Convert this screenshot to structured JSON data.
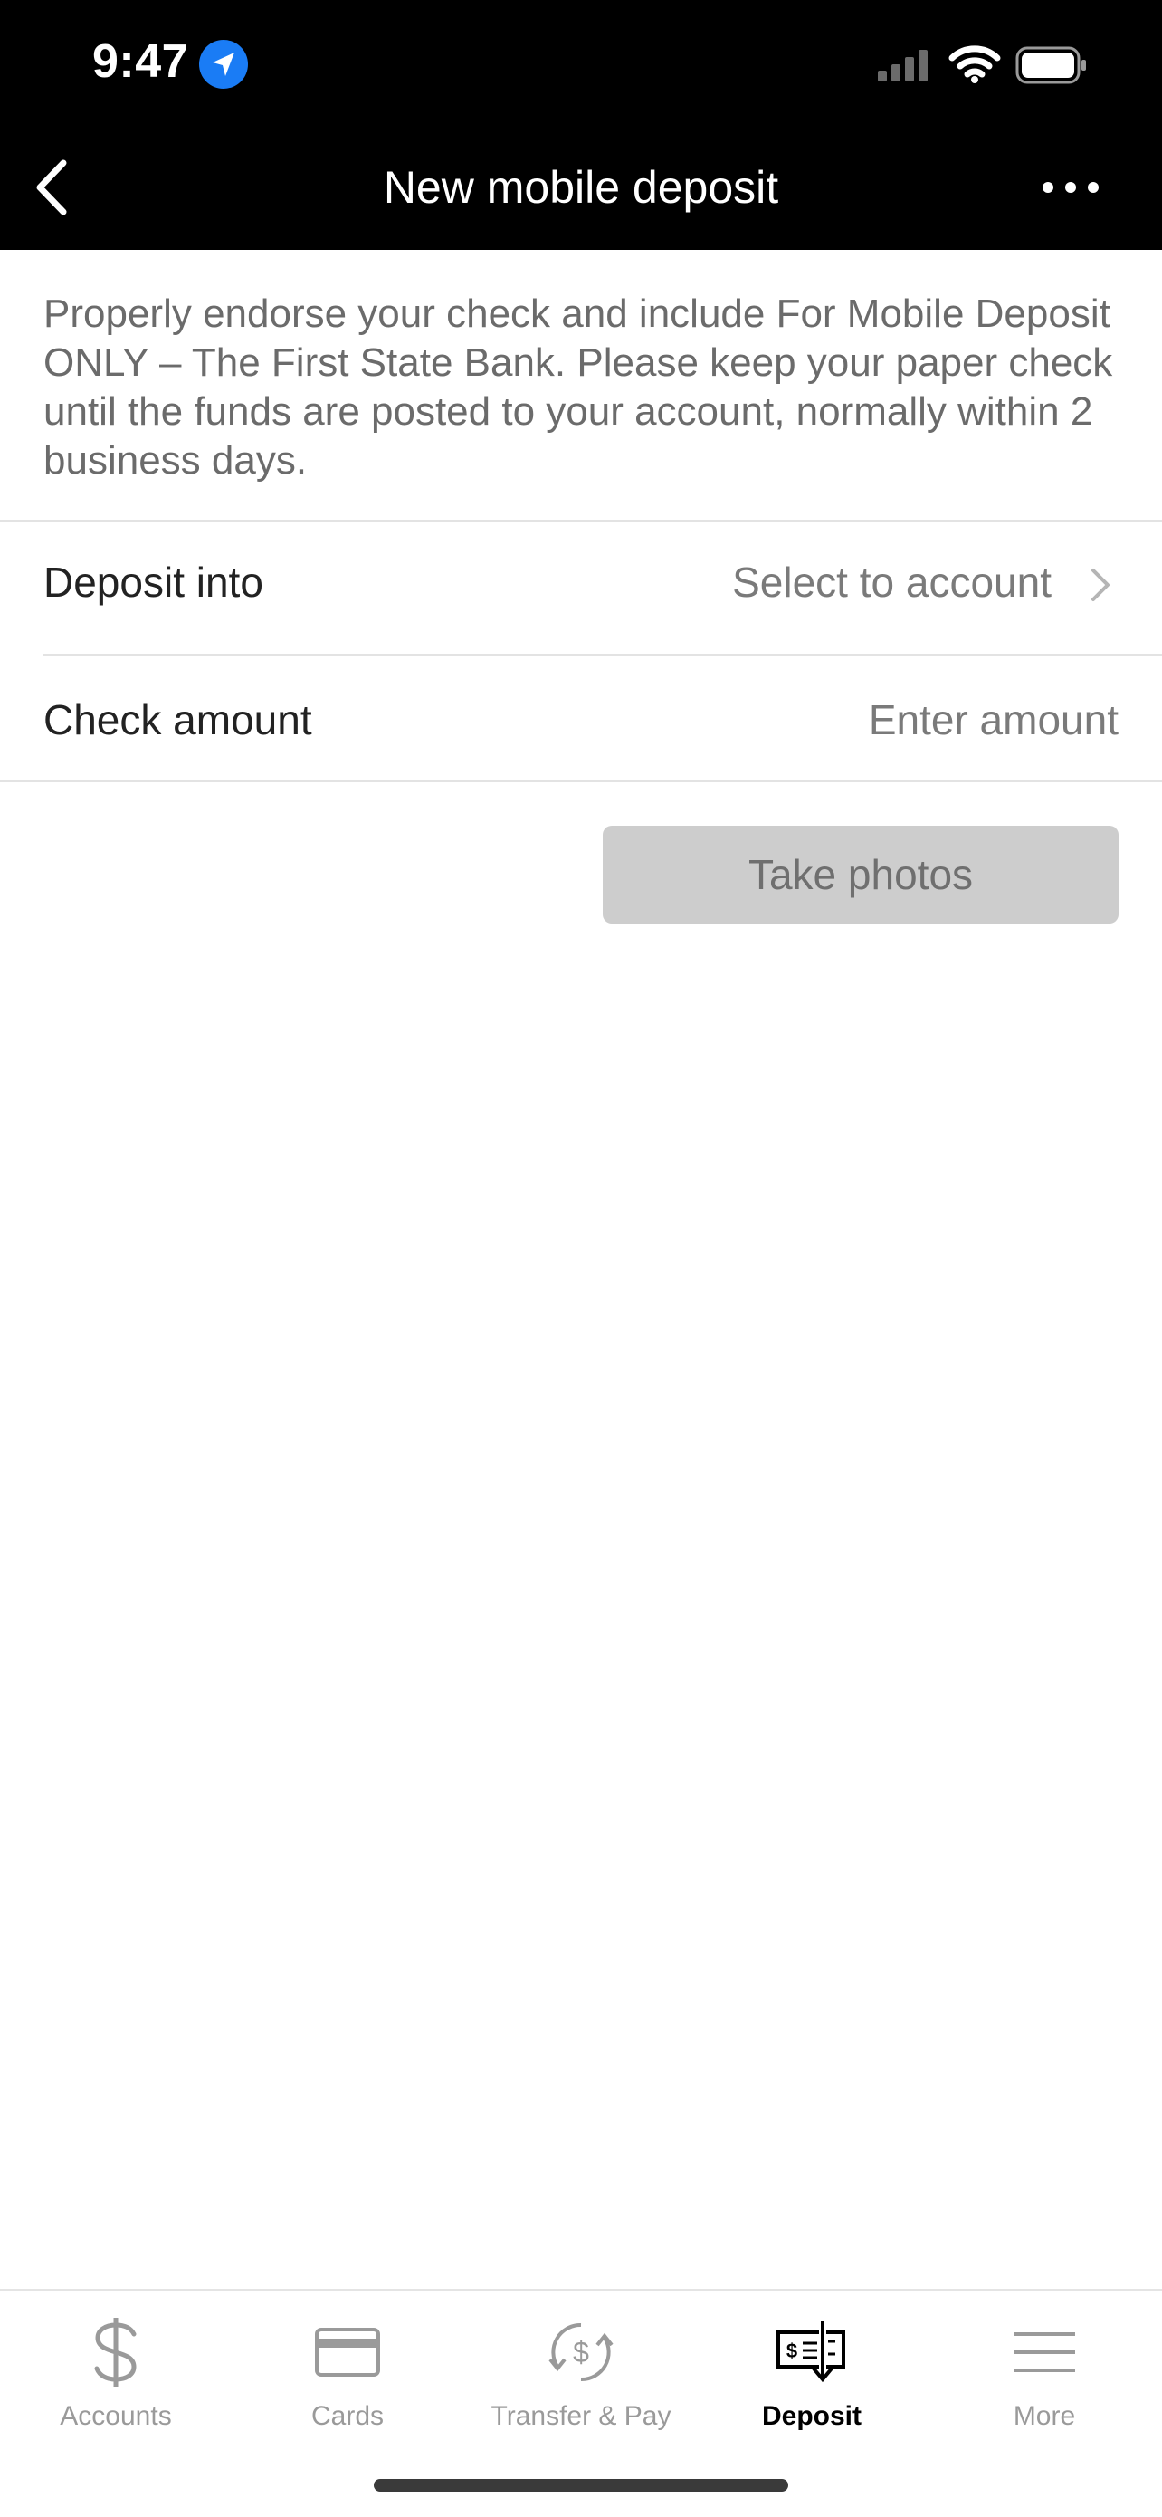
{
  "status_bar": {
    "time": "9:47"
  },
  "header": {
    "title": "New mobile deposit"
  },
  "intro_text": "Properly endorse your check and include For Mobile Deposit ONLY – The First State Bank. Please keep your paper check until the funds are posted to your account, normally within 2 business days.",
  "form": {
    "deposit_into": {
      "label": "Deposit into",
      "value": "Select to account"
    },
    "check_amount": {
      "label": "Check amount",
      "placeholder": "Enter amount"
    }
  },
  "take_photos_label": "Take photos",
  "tabs": [
    {
      "label": "Accounts",
      "icon": "dollar-icon"
    },
    {
      "label": "Cards",
      "icon": "card-icon"
    },
    {
      "label": "Transfer & Pay",
      "icon": "transfer-icon"
    },
    {
      "label": "Deposit",
      "icon": "check-deposit-icon",
      "active": true
    },
    {
      "label": "More",
      "icon": "menu-icon"
    }
  ],
  "colors": {
    "header_bg": "#000000",
    "location_badge": "#1a7cf5",
    "button_disabled": "#cdcdcd",
    "tab_inactive": "#9a9a9a",
    "tab_active": "#000000"
  }
}
